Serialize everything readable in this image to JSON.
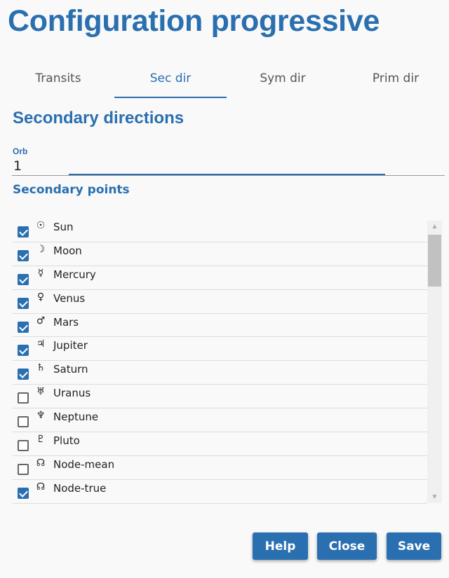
{
  "title": "Configuration progressive",
  "tabs": [
    {
      "label": "Transits",
      "active": false
    },
    {
      "label": "Sec dir",
      "active": true
    },
    {
      "label": "Sym dir",
      "active": false
    },
    {
      "label": "Prim dir",
      "active": false
    }
  ],
  "section_title": "Secondary directions",
  "orb": {
    "label": "Orb",
    "value": "1"
  },
  "points_title": "Secondary points",
  "points": [
    {
      "glyph": "☉",
      "name": "Sun",
      "checked": true
    },
    {
      "glyph": "☽",
      "name": "Moon",
      "checked": true
    },
    {
      "glyph": "☿",
      "name": "Mercury",
      "checked": true
    },
    {
      "glyph": "♀",
      "name": "Venus",
      "checked": true
    },
    {
      "glyph": "♂",
      "name": "Mars",
      "checked": true
    },
    {
      "glyph": "♃",
      "name": "Jupiter",
      "checked": true
    },
    {
      "glyph": "♄",
      "name": "Saturn",
      "checked": true
    },
    {
      "glyph": "♅",
      "name": "Uranus",
      "checked": false
    },
    {
      "glyph": "♆",
      "name": "Neptune",
      "checked": false
    },
    {
      "glyph": "♇",
      "name": "Pluto",
      "checked": false
    },
    {
      "glyph": "☊",
      "name": "Node-mean",
      "checked": false
    },
    {
      "glyph": "☊",
      "name": "Node-true",
      "checked": true
    }
  ],
  "buttons": {
    "help": "Help",
    "close": "Close",
    "save": "Save"
  },
  "colors": {
    "accent": "#2a6fb0"
  }
}
